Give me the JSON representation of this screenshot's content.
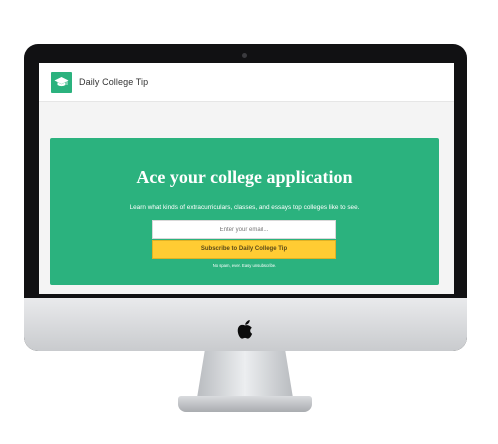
{
  "header": {
    "brand": "Daily College Tip",
    "logo_icon": "graduation-cap-icon"
  },
  "hero": {
    "title": "Ace your college application",
    "subtitle": "Learn what kinds of extracurriculars, classes, and essays top colleges like to see.",
    "email_placeholder": "Enter your email...",
    "subscribe_label": "Subscribe to Daily College Tip",
    "fine_print": "No spam, ever. Easy unsubscribe."
  },
  "colors": {
    "accent": "#2bb27e",
    "button": "#ffcc33",
    "bezel": "#111113"
  }
}
